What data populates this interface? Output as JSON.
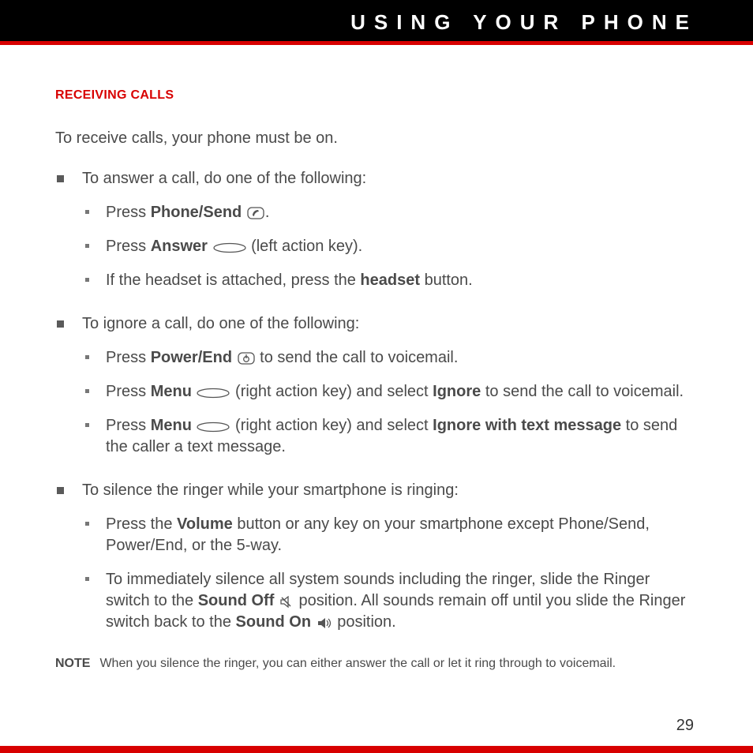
{
  "header": {
    "title": "USING YOUR PHONE"
  },
  "section": {
    "title": "RECEIVING CALLS"
  },
  "intro": "To receive calls, your phone must be on.",
  "b1": {
    "lead": "To answer a call, do one of the following:",
    "s1a": "Press ",
    "s1b": "Phone/Send",
    "s1c": ".",
    "s2a": "Press ",
    "s2b": "Answer",
    "s2c": " (left action key).",
    "s3a": "If the headset is attached, press the ",
    "s3b": "headset",
    "s3c": " button."
  },
  "b2": {
    "lead": "To ignore a call, do one of the following:",
    "s1a": "Press ",
    "s1b": "Power/End",
    "s1c": " to send the call to voicemail.",
    "s2a": "Press ",
    "s2b": "Menu",
    "s2c": " (right action key) and select ",
    "s2d": "Ignore",
    "s2e": " to send the call to voicemail.",
    "s3a": "Press ",
    "s3b": "Menu",
    "s3c": " (right action key) and select ",
    "s3d": "Ignore with text message",
    "s3e": " to send the caller a text message."
  },
  "b3": {
    "lead": "To silence the ringer while your smartphone is ringing:",
    "s1a": "Press the ",
    "s1b": "Volume",
    "s1c": " button or any key on your smartphone except Phone/Send, Power/End, or the 5-way.",
    "s2a": "To immediately silence all system sounds including the ringer, slide the Ringer switch to the ",
    "s2b": "Sound Off",
    "s2c": " position. All sounds remain off until you slide the Ringer switch back to the ",
    "s2d": "Sound On",
    "s2e": " position."
  },
  "note": {
    "label": "NOTE",
    "text": "When you silence the ringer, you can either answer the call or let it ring through to voicemail."
  },
  "pageNumber": "29",
  "icons": {
    "phone_send": "phone-send-key-icon",
    "action_key": "action-key-icon",
    "power_end": "power-end-key-icon",
    "sound_off": "sound-off-icon",
    "sound_on": "sound-on-icon"
  }
}
